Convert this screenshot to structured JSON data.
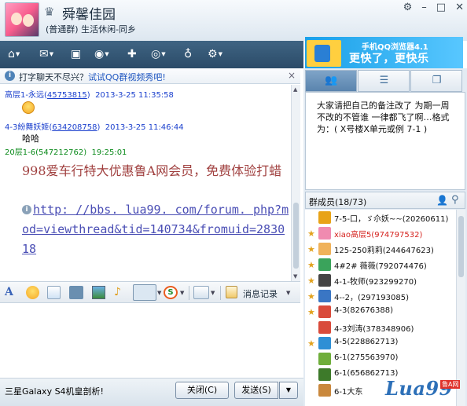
{
  "window": {
    "group_name": "舜馨佳园",
    "group_type": "(普通群) 生活休闲-同乡",
    "controls": [
      "⚙",
      "–",
      "□",
      "✕"
    ]
  },
  "banner": {
    "subtitle": "手机QQ浏览器4.1",
    "slogan": "更快了，更快乐"
  },
  "adline": {
    "text": "打字聊天不尽兴？",
    "link": "试试QQ群视频秀吧!",
    "close": "×"
  },
  "messages": [
    {
      "sender": "高层1-永远",
      "uid": "45753815",
      "time": "2013-3-25 11:35:58",
      "color": "#1a3fcd"
    },
    {
      "sender": "4-3紛舞妖姬",
      "uid": "634208758",
      "time": "2013-3-25 11:46:44",
      "color": "#1a3fcd",
      "body": "哈哈"
    },
    {
      "sender": "20层1-6",
      "uid": "547212762",
      "time": "19:25:01",
      "color": "#0b8a1b"
    }
  ],
  "ad_message": {
    "text": "998爱车行特大优惠鲁A网会员，免费体验打蜡",
    "url": "http: //bbs. lua99. com/forum. php?mod=viewthread&tid=140734&fromuid=283018"
  },
  "format_toolbar": {
    "font_glyph": "A",
    "history_label": "消息记录"
  },
  "bottom": {
    "ad_text": "三星Galaxy S4机皇剖析!",
    "close_label": "关闭(C)",
    "send_label": "发送(S)",
    "send_caret": "▼"
  },
  "right_panel": {
    "tabs": [
      {
        "name": "info",
        "icon": "people-icon"
      },
      {
        "name": "members",
        "icon": "list-icon"
      },
      {
        "name": "files",
        "icon": "windows-icon"
      }
    ],
    "notice": "大家请把自己的备注改了 为期一周 不改的不管谁 一律都飞了啊…格式为：( X号楼X单元或例 7-1 )",
    "members_title": "群成员(18/73)",
    "members": [
      {
        "name": "7-5-口，ゞ尒妖~~(20260611)",
        "red": false,
        "star": false,
        "avatar_color": "#e8a317"
      },
      {
        "name": "xiao高层5(974797532)",
        "red": true,
        "star": true,
        "avatar_color": "#f08bb0"
      },
      {
        "name": "125-250莉莉(244647623)",
        "red": false,
        "star": true,
        "avatar_color": "#f0b25a"
      },
      {
        "name": "4#2# 薇薇(792074476)",
        "red": false,
        "star": true,
        "avatar_color": "#3aa35b"
      },
      {
        "name": "4-1-牧师(923299270)",
        "red": false,
        "star": true,
        "avatar_color": "#444444"
      },
      {
        "name": "4--2，(297193085)",
        "red": false,
        "star": true,
        "avatar_color": "#3a76c4"
      },
      {
        "name": "4-3(82676388)",
        "red": false,
        "star": true,
        "avatar_color": "#d94b3b"
      },
      {
        "name": "4-3刘涛(378348906)",
        "red": false,
        "star": false,
        "avatar_color": "#d94b3b"
      },
      {
        "name": "4-5(228862713)",
        "red": false,
        "star": true,
        "avatar_color": "#2f8fd5"
      },
      {
        "name": "6-1(275563970)",
        "red": false,
        "star": false,
        "avatar_color": "#6fae3b"
      },
      {
        "name": "6-1(656862713)",
        "red": false,
        "star": false,
        "avatar_color": "#3d7a2a"
      },
      {
        "name": "6-1大东",
        "red": false,
        "star": false,
        "avatar_color": "#c9883d"
      }
    ]
  },
  "watermark": {
    "main": "Lua99",
    "tag": "鲁A网"
  }
}
